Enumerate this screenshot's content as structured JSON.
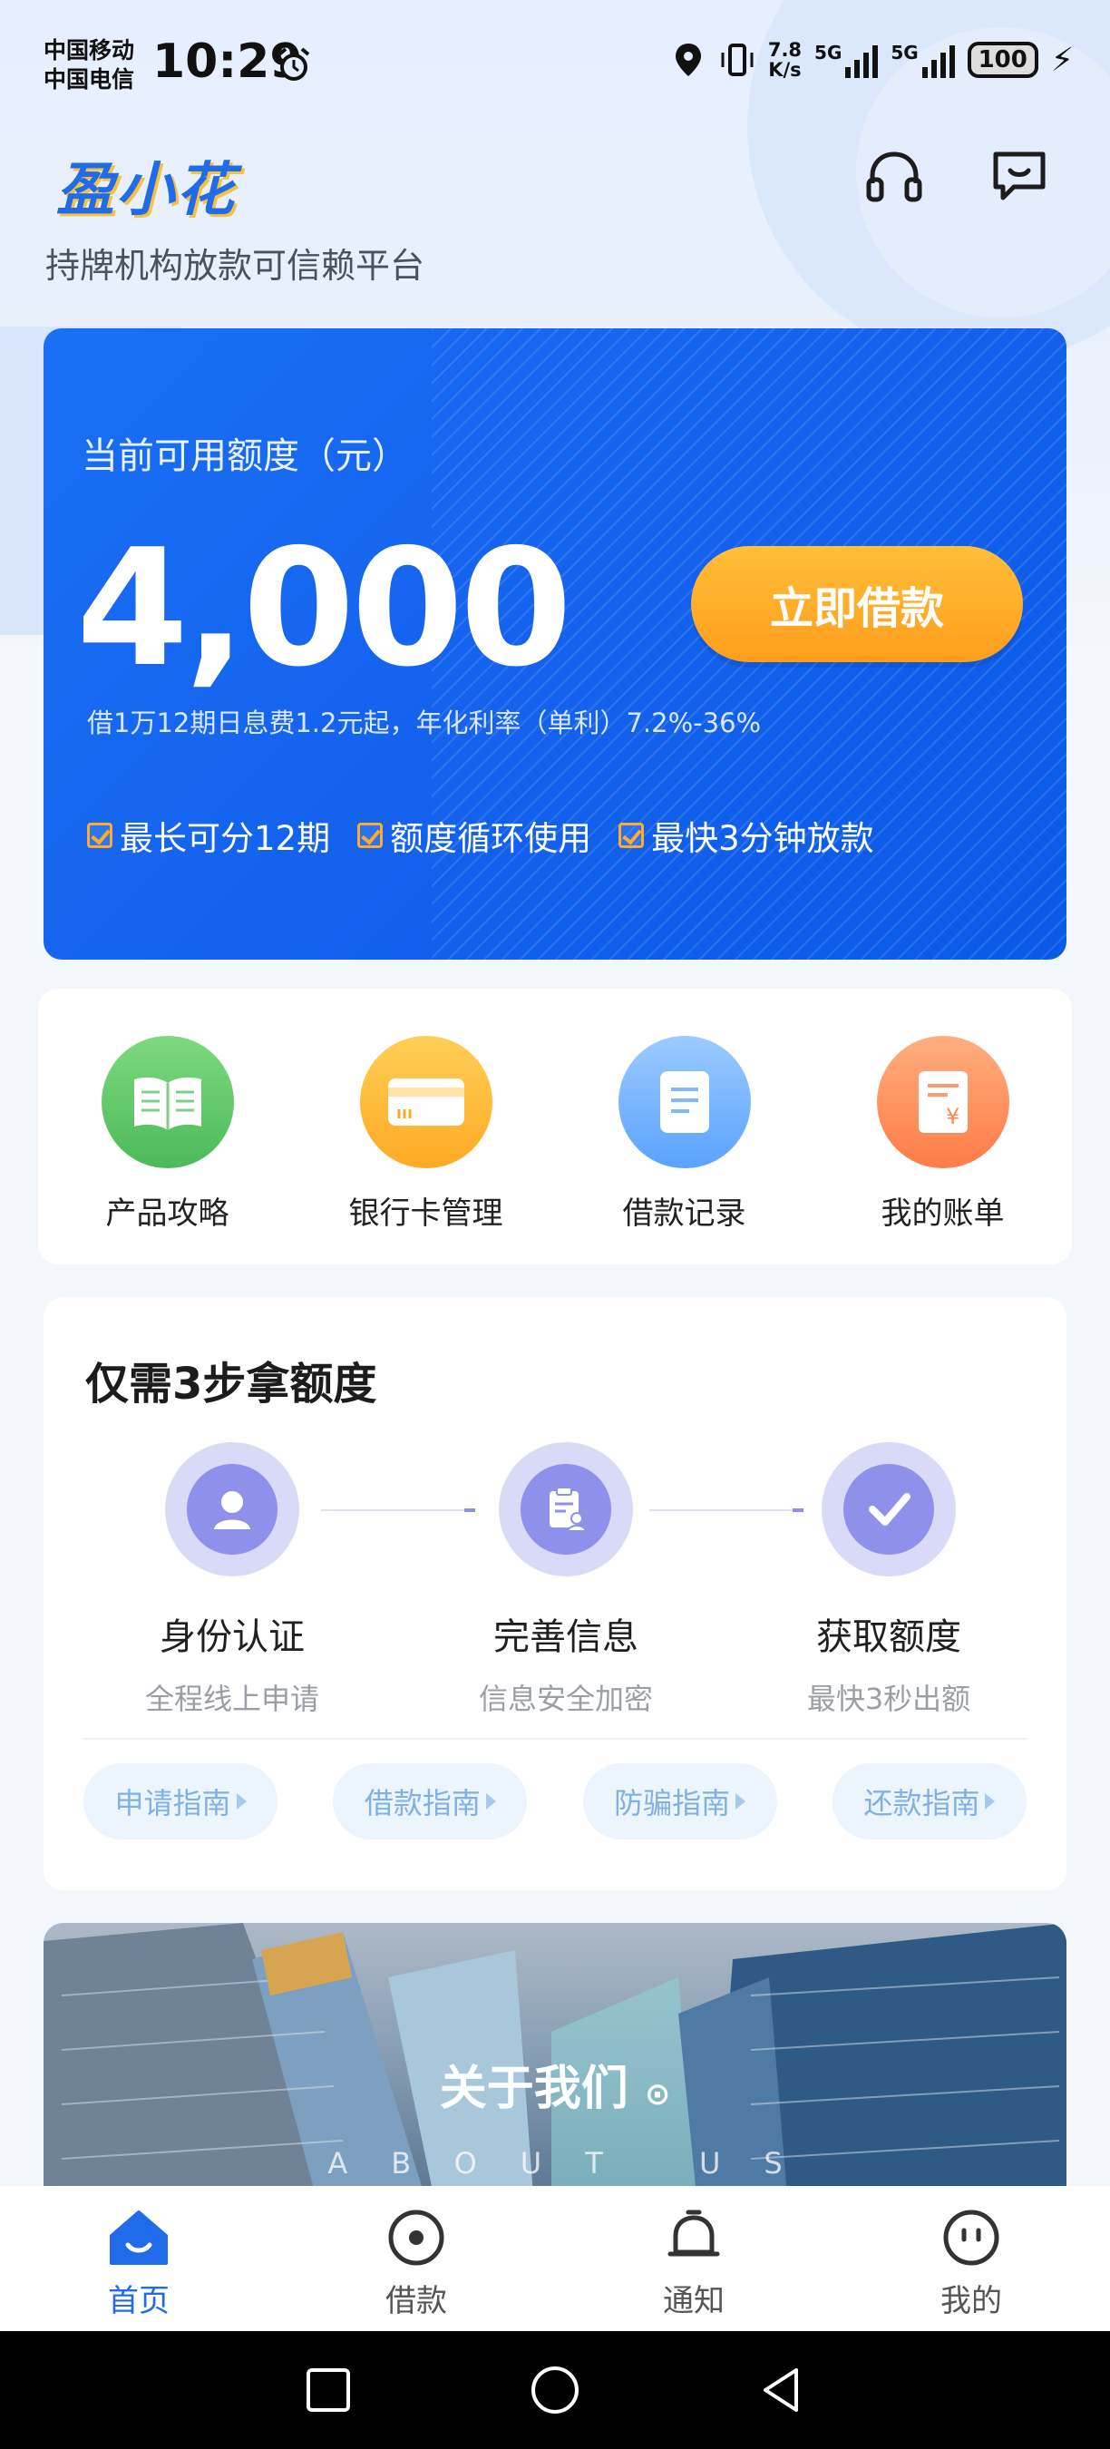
{
  "status_bar": {
    "carrier1": "中国移动",
    "carrier2": "中国电信",
    "time": "10:29",
    "net_speed_value": "7.8",
    "net_speed_unit": "K/s",
    "sig1_label": "5G",
    "sig2_label": "5G",
    "battery": "100"
  },
  "header": {
    "logo_text": "盈小花",
    "tagline": "持牌机构放款可信赖平台"
  },
  "credit_card": {
    "label": "当前可用额度（元）",
    "amount": "4,000",
    "borrow_button": "立即借款",
    "rate_text": "借1万12期日息费1.2元起，年化利率（单利）7.2%-36%",
    "features": [
      "最长可分12期",
      "额度循环使用",
      "最快3分钟放款"
    ]
  },
  "shortcuts": [
    {
      "label": "产品攻略",
      "icon": "book-icon",
      "color": "#5bc565"
    },
    {
      "label": "银行卡管理",
      "icon": "bank-card-icon",
      "color": "#ffb632"
    },
    {
      "label": "借款记录",
      "icon": "document-icon",
      "color": "#6aabff"
    },
    {
      "label": "我的账单",
      "icon": "bill-icon",
      "color": "#ff8a55"
    }
  ],
  "steps": {
    "title": "仅需3步拿额度",
    "items": [
      {
        "title": "身份认证",
        "subtitle": "全程线上申请",
        "icon": "user-icon"
      },
      {
        "title": "完善信息",
        "subtitle": "信息安全加密",
        "icon": "clipboard-user-icon"
      },
      {
        "title": "获取额度",
        "subtitle": "最快3秒出额",
        "icon": "check-icon"
      }
    ],
    "guides": [
      "申请指南",
      "借款指南",
      "防骗指南",
      "还款指南"
    ]
  },
  "about": {
    "title": "关于我们",
    "subtitle": "ABOUT US"
  },
  "bottom_nav": [
    {
      "label": "首页",
      "icon": "home-icon",
      "active": true
    },
    {
      "label": "借款",
      "icon": "loan-icon",
      "active": false
    },
    {
      "label": "通知",
      "icon": "bell-icon",
      "active": false
    },
    {
      "label": "我的",
      "icon": "profile-icon",
      "active": false
    }
  ],
  "colors": {
    "primary": "#1f6bea",
    "accent": "#ffa923",
    "step_purple": "#8f90ea"
  }
}
